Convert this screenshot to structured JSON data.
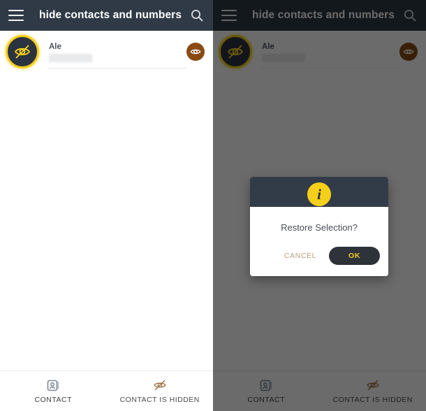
{
  "appbar": {
    "title": "hide contacts and numbers",
    "menu_icon": "hamburger-menu-icon",
    "search_icon": "search-icon"
  },
  "contact_row": {
    "avatar_icon": "eye-slash-icon",
    "name": "Ale",
    "number": "",
    "restore_icon": "eye-icon"
  },
  "bottom_nav": {
    "tabs": [
      {
        "label": "CONTACT",
        "icon": "contact-card-icon"
      },
      {
        "label": "CONTACT IS HIDDEN",
        "icon": "eye-slash-icon"
      }
    ]
  },
  "dialog": {
    "icon": "info-icon",
    "icon_glyph": "i",
    "message": "Restore Selection?",
    "cancel_label": "CANCEL",
    "ok_label": "OK"
  },
  "colors": {
    "appbar": "#2f3a46",
    "accent_yellow": "#f6cf1a",
    "dialog_header": "#323c49",
    "restore_button": "#8a4a14",
    "cancel_text": "#b4a07a",
    "scrim": "rgba(0,0,0,0.58)"
  }
}
